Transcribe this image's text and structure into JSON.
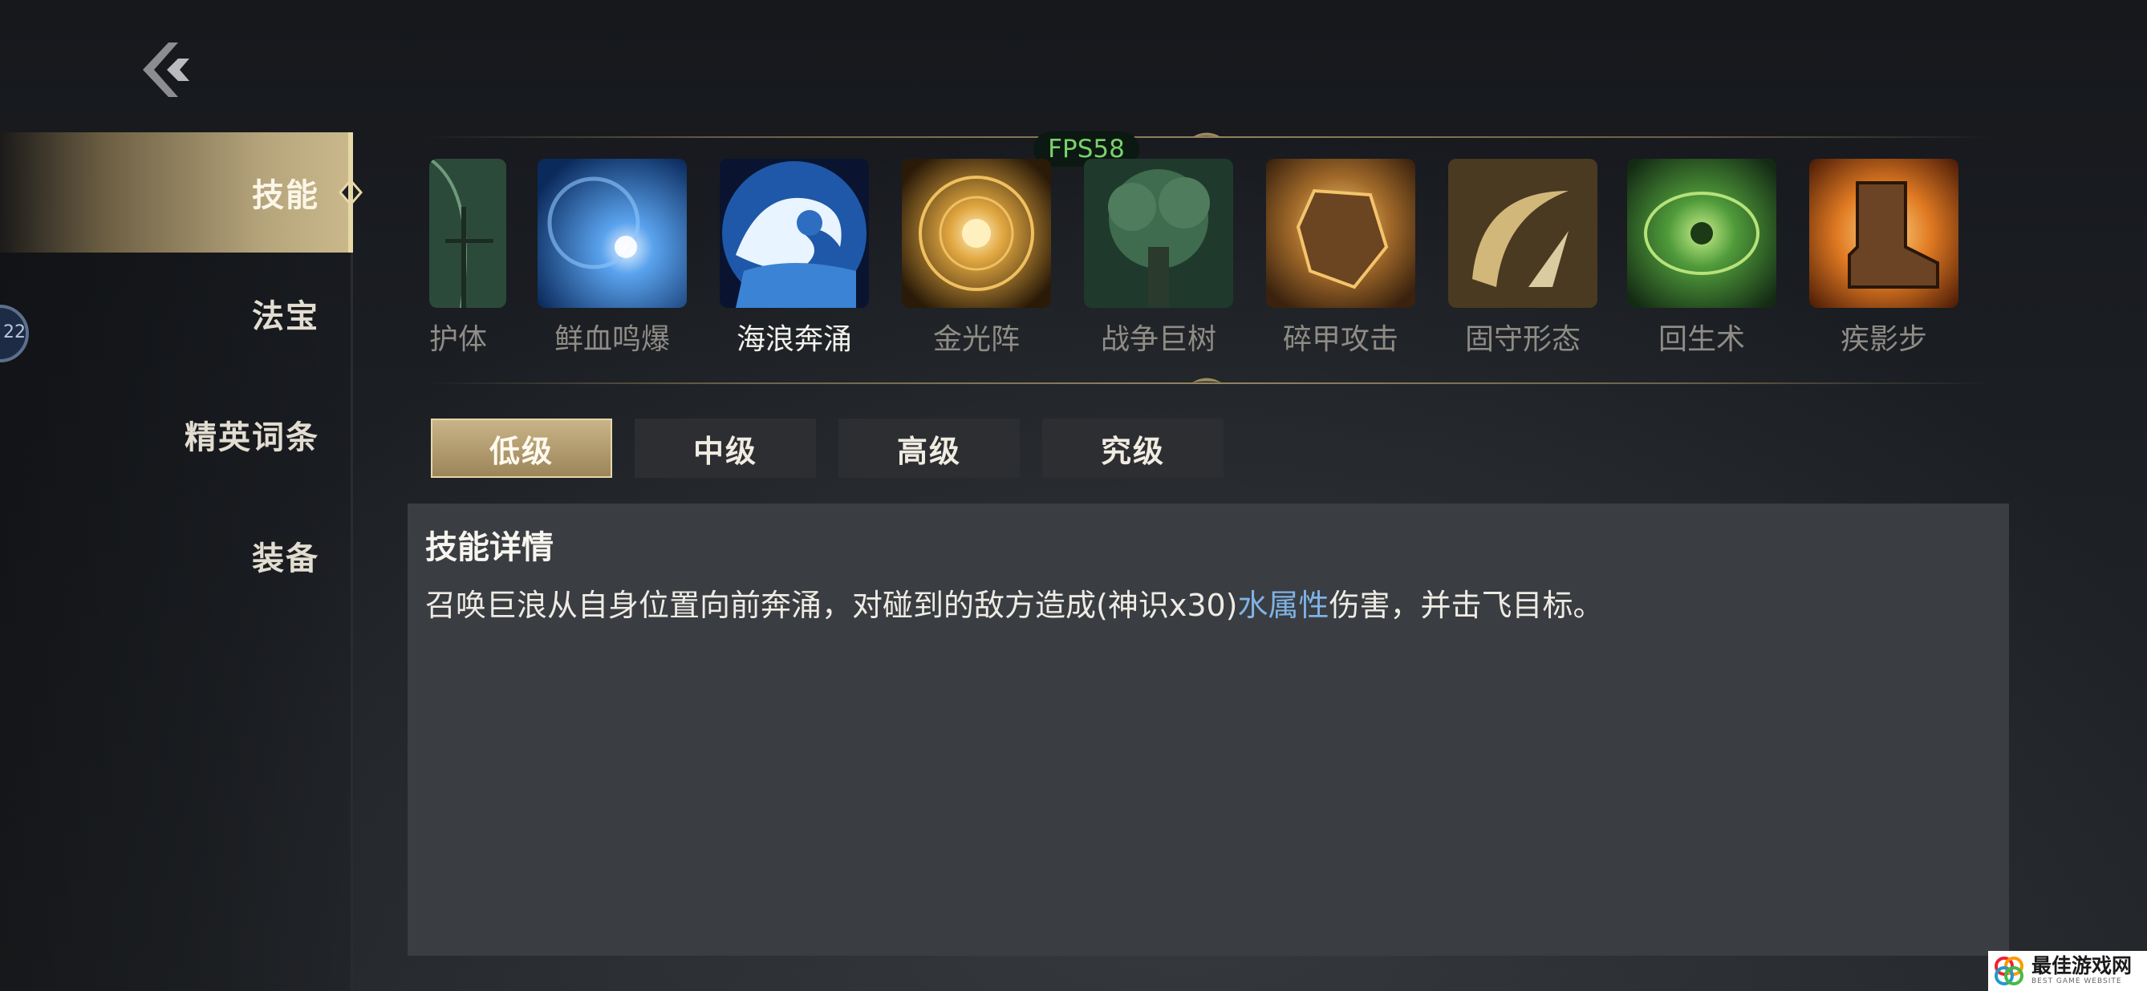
{
  "nav": {
    "items": [
      {
        "label": "技能",
        "active": true
      },
      {
        "label": "法宝",
        "active": false
      },
      {
        "label": "精英词条",
        "active": false
      },
      {
        "label": "装备",
        "active": false
      }
    ]
  },
  "side_badge": "22",
  "fps": "FPS58",
  "skills": [
    {
      "name": "护体"
    },
    {
      "name": "鲜血鸣爆"
    },
    {
      "name": "海浪奔涌",
      "selected": true
    },
    {
      "name": "金光阵"
    },
    {
      "name": "战争巨树"
    },
    {
      "name": "碎甲攻击"
    },
    {
      "name": "固守形态"
    },
    {
      "name": "回生术"
    },
    {
      "name": "疾影步"
    }
  ],
  "levels": [
    "低级",
    "中级",
    "高级",
    "究级"
  ],
  "active_level": "低级",
  "detail": {
    "title": "技能详情",
    "desc_before": "召唤巨浪从自身位置向前奔涌，对碰到的敌方造成(神识x30)",
    "desc_highlight": "水属性",
    "desc_after": "伤害，并击飞目标。"
  },
  "watermark": {
    "title": "最佳游戏网",
    "subtitle": "BEST GAME WEBSITE"
  },
  "colors": {
    "active_gold": "#b6a57c",
    "highlight_blue": "#7fb2e6",
    "fps_green": "#79d16b"
  }
}
